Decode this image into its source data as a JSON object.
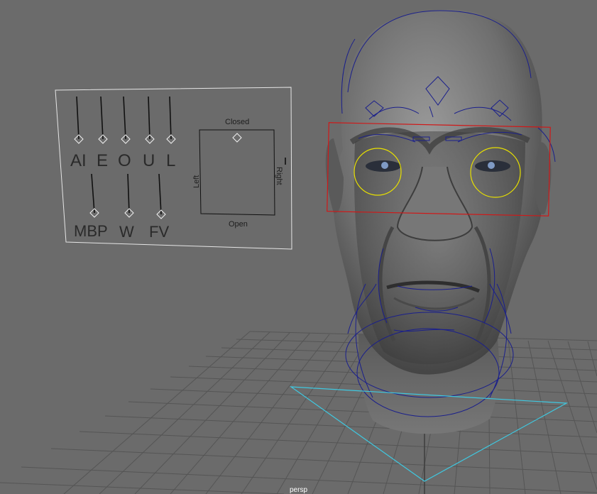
{
  "viewport": {
    "camera_label": "persp",
    "background_color": "#6b6b6b"
  },
  "lipsync_panel": {
    "phoneme_sliders": [
      {
        "label": "AI"
      },
      {
        "label": "E"
      },
      {
        "label": "O"
      },
      {
        "label": "U"
      },
      {
        "label": "L"
      },
      {
        "label": "MBP"
      },
      {
        "label": "W"
      },
      {
        "label": "FV"
      }
    ],
    "jaw_pad": {
      "top_label": "Closed",
      "bottom_label": "Open",
      "left_label": "Left",
      "right_label": "Right"
    }
  },
  "rig_controls": {
    "eye_box_color": "#d01818",
    "eye_circle_color": "#e8e000",
    "face_curve_color": "#1a1f8c",
    "ground_control_color": "#3fc8e0"
  }
}
